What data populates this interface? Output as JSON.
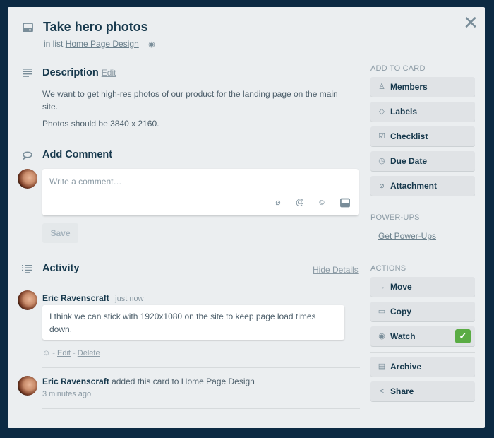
{
  "card": {
    "title": "Take hero photos",
    "in_list_prefix": "in list",
    "list_name": "Home Page Design"
  },
  "description": {
    "heading": "Description",
    "edit_label": "Edit",
    "paragraphs": [
      "We want to get high-res photos of our product for the landing page on the main site.",
      "Photos should be 3840 x 2160."
    ]
  },
  "add_comment": {
    "heading": "Add Comment",
    "placeholder": "Write a comment…",
    "save_label": "Save"
  },
  "activity": {
    "heading": "Activity",
    "hide_details_label": "Hide Details",
    "items": [
      {
        "author": "Eric Ravenscraft",
        "time": "just now",
        "comment": "I think we can stick with 1920x1080 on the site to keep page load times down.",
        "edit_label": "Edit",
        "delete_label": "Delete"
      },
      {
        "author": "Eric Ravenscraft",
        "action": "added this card to Home Page Design",
        "time": "3 minutes ago"
      }
    ]
  },
  "sidebar": {
    "add_to_card_label": "ADD TO CARD",
    "add_to_card": [
      {
        "label": "Members",
        "icon": "person-icon"
      },
      {
        "label": "Labels",
        "icon": "tag-icon"
      },
      {
        "label": "Checklist",
        "icon": "checkbox-icon"
      },
      {
        "label": "Due Date",
        "icon": "clock-icon"
      },
      {
        "label": "Attachment",
        "icon": "paperclip-icon"
      }
    ],
    "power_ups_label": "POWER-UPS",
    "get_power_ups_label": "Get Power-Ups",
    "actions_label": "ACTIONS",
    "actions": [
      {
        "label": "Move",
        "icon": "arrow-right-icon"
      },
      {
        "label": "Copy",
        "icon": "card-icon"
      },
      {
        "label": "Watch",
        "icon": "eye-icon",
        "checked": true
      },
      {
        "label": "Archive",
        "icon": "archive-icon"
      },
      {
        "label": "Share",
        "icon": "share-icon"
      }
    ]
  },
  "colors": {
    "backdrop": "#0c2a43",
    "modal_bg": "#ebeef0",
    "text_primary": "#17394d",
    "watch_check": "#5aac44"
  }
}
